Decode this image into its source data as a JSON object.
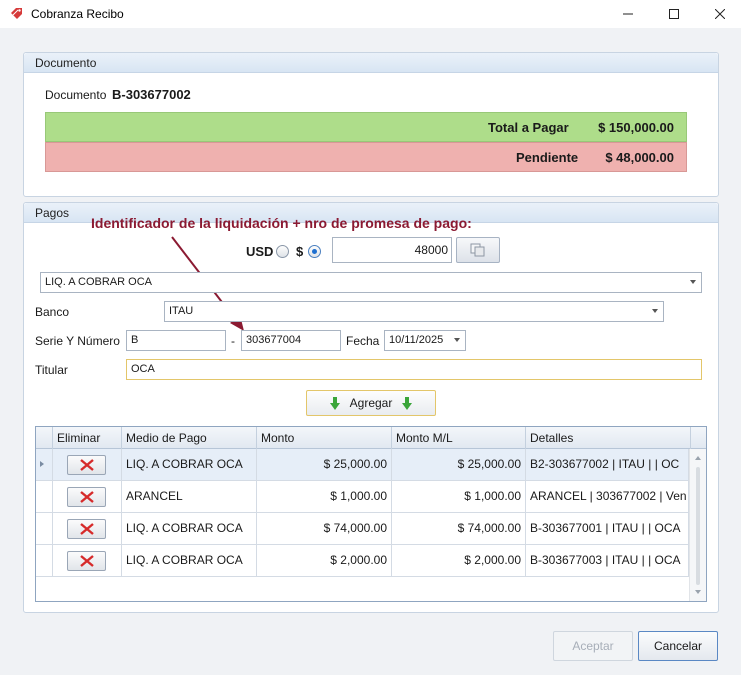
{
  "window": {
    "title": "Cobranza Recibo",
    "accent": "#d63a3a"
  },
  "documento": {
    "section_title": "Documento",
    "label": "Documento",
    "value": "B-303677002",
    "total_label": "Total a Pagar",
    "total_amount": "$ 150,000.00",
    "total_color": "#aedd8a",
    "pendiente_label": "Pendiente",
    "pendiente_amount": "$ 48,000.00",
    "pendiente_color": "#efb1af"
  },
  "pagos": {
    "section_title": "Pagos",
    "annotation": "Identificador de la liquidación + nro de promesa de pago:",
    "currency_usd": "USD",
    "currency_peso": "$",
    "selected_currency": "$",
    "amount": "48000",
    "medio_pago": "LIQ. A COBRAR OCA",
    "banco_label": "Banco",
    "banco": "ITAU",
    "serie_label": "Serie Y Número",
    "serie": "B",
    "dash": "-",
    "numero": "303677004",
    "fecha_label": "Fecha",
    "fecha": "10/11/2025",
    "titular_label": "Titular",
    "titular": "OCA",
    "agregar_label": "Agregar"
  },
  "grid": {
    "columns": [
      "Eliminar",
      "Medio de Pago",
      "Monto",
      "Monto M/L",
      "Detalles"
    ],
    "rows": [
      {
        "medio": "LIQ. A COBRAR OCA",
        "monto": "$ 25,000.00",
        "monto_ml": "$ 25,000.00",
        "detalles": "B2-303677002  |  ITAU |  | OC"
      },
      {
        "medio": "ARANCEL",
        "monto": "$ 1,000.00",
        "monto_ml": "$ 1,000.00",
        "detalles": "ARANCEL | 303677002  | Ven"
      },
      {
        "medio": "LIQ. A COBRAR OCA",
        "monto": "$ 74,000.00",
        "monto_ml": "$ 74,000.00",
        "detalles": "B-303677001  |  ITAU |  | OCA"
      },
      {
        "medio": "LIQ. A COBRAR OCA",
        "monto": "$ 2,000.00",
        "monto_ml": "$ 2,000.00",
        "detalles": "B-303677003  |  ITAU |  | OCA"
      }
    ]
  },
  "footer": {
    "accept_label": "Aceptar",
    "cancel_label": "Cancelar"
  },
  "icons": {
    "app": "receipt-tag-icon",
    "delete": "red-x-icon",
    "add": "green-down-arrow-icon",
    "copy": "copy-icon"
  }
}
